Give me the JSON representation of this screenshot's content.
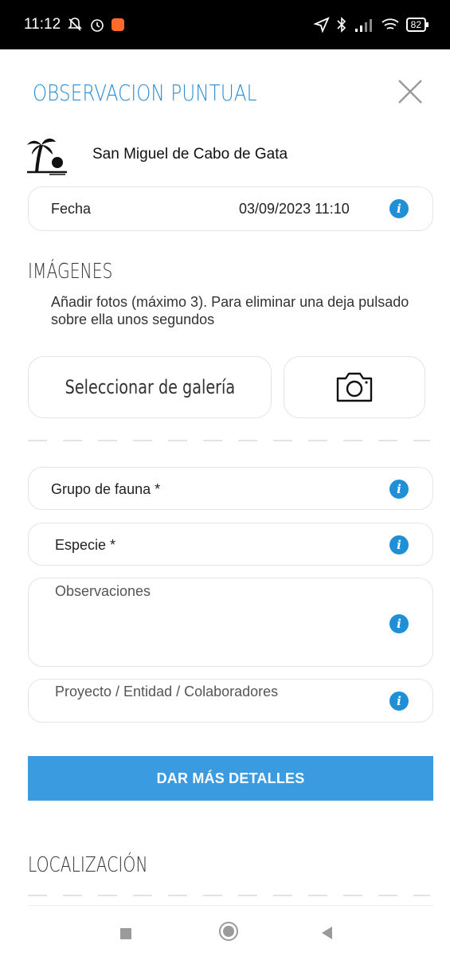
{
  "status_bar": {
    "time": "11:12",
    "battery": "82",
    "icons": [
      "notifications-off-icon",
      "alarm-icon",
      "app-badge-icon",
      "location-arrow-icon",
      "bluetooth-icon",
      "signal-icon",
      "wifi-icon",
      "battery-icon"
    ]
  },
  "header": {
    "title": "OBSERVACION PUNTUAL",
    "close_icon": "close-icon"
  },
  "location": {
    "icon": "palm-beach-icon",
    "name": "San Miguel de Cabo de Gata"
  },
  "fecha": {
    "label": "Fecha",
    "value": "03/09/2023 11:10"
  },
  "imagenes": {
    "heading": "IMÁGENES",
    "description": "Añadir fotos (máximo 3). Para eliminar una deja pulsado sobre ella unos segundos",
    "gallery_button": "Seleccionar de galería",
    "camera_icon": "camera-icon"
  },
  "fields": {
    "grupo_fauna": "Grupo de fauna *",
    "especie": "Especie *",
    "observaciones": "Observaciones",
    "proyecto": "Proyecto / Entidad / Colaboradores"
  },
  "info_symbol": "i",
  "details_button": "DAR MÁS DETALLES",
  "localizacion": {
    "heading": "LOCALIZACIÓN"
  },
  "colors": {
    "accent": "#2a8cd2",
    "button": "#3b9be0",
    "info": "#1f8fd6"
  }
}
